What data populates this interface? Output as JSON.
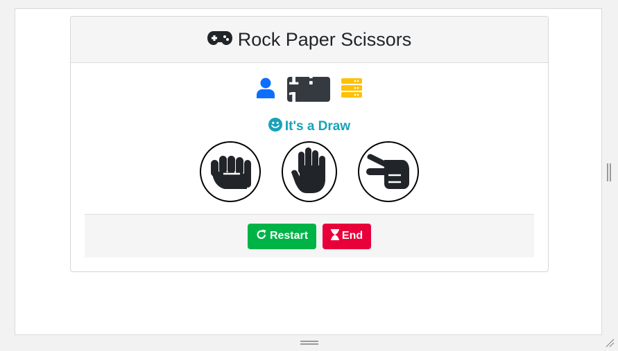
{
  "header": {
    "title": "Rock Paper Scissors",
    "icon": "gamepad-icon"
  },
  "score": {
    "player_icon": "user-icon",
    "text": "1 : 1",
    "computer_icon": "server-icon"
  },
  "result": {
    "icon": "smile-icon",
    "text": "It's a Draw"
  },
  "choices": [
    {
      "name": "rock",
      "icon": "hand-rock-icon"
    },
    {
      "name": "paper",
      "icon": "hand-paper-icon"
    },
    {
      "name": "scissors",
      "icon": "hand-scissors-icon"
    }
  ],
  "footer": {
    "restart_label": "Restart",
    "end_label": "End"
  },
  "colors": {
    "player": "#0d6efd",
    "computer": "#ffc107",
    "result": "#17a2b8",
    "restart": "#00b347",
    "end": "#e8003a",
    "score_badge": "#343a40"
  }
}
